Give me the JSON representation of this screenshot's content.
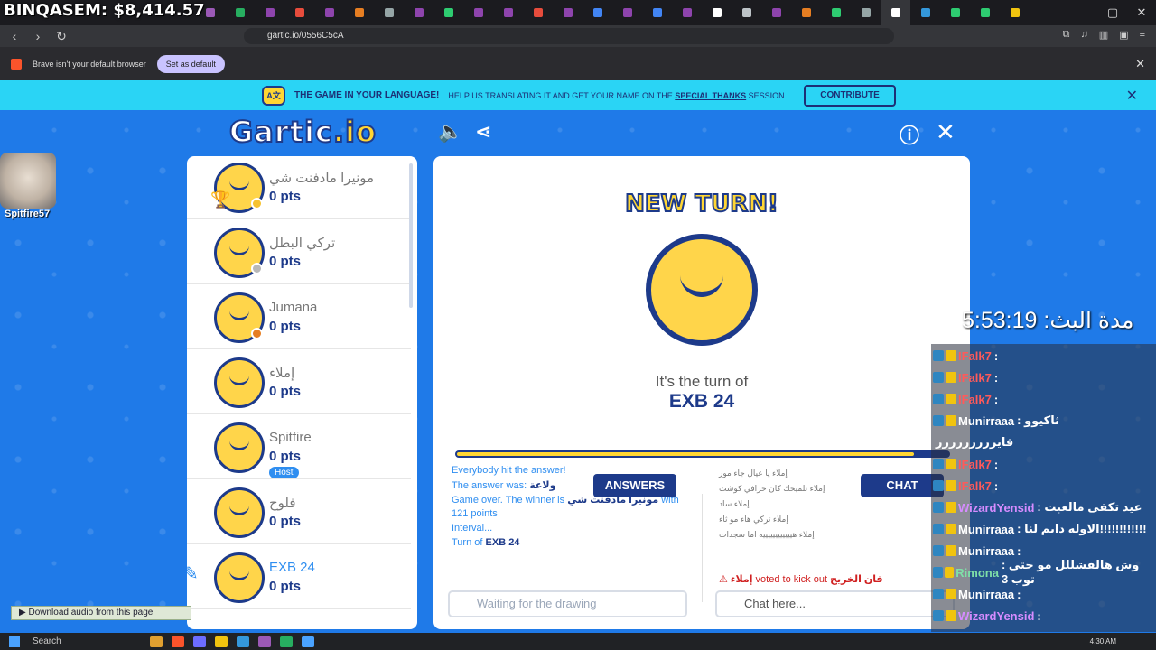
{
  "browser": {
    "url": "gartic.io/0556C5cA",
    "infobar_message": "Brave isn't your default browser",
    "set_default_label": "Set as default",
    "tab_colors": [
      "#9b59b6",
      "#27ae60",
      "#8e44ad",
      "#e74c3c",
      "#8e44ad",
      "#e67e22",
      "#95a5a6",
      "#8e44ad",
      "#2ecc71",
      "#8e44ad",
      "#8e44ad",
      "#e74c3c",
      "#8e44ad",
      "#4285f4",
      "#8e44ad",
      "#4285f4",
      "#8e44ad",
      "#ffffff",
      "#bdc3c7",
      "#8e44ad",
      "#e67e22",
      "#2ecc71",
      "#95a5a6",
      "#ffffff",
      "#3498db",
      "#2ecc71",
      "#2ecc71",
      "#f1c40f"
    ]
  },
  "stream_overlay": {
    "money": "BINQASEM: $8,414.57",
    "cam_name": "Spitfire57",
    "timer": "مدة البث: 5:53:19",
    "chat": [
      {
        "user": "IFalk7",
        "text": ":",
        "color": "#ff5a5a"
      },
      {
        "user": "IFalk7",
        "text": ":",
        "color": "#ff5a5a"
      },
      {
        "user": "IFalk7",
        "text": ":",
        "color": "#ff5a5a"
      },
      {
        "user": "Munirraaa",
        "text": ": ثاكيوو",
        "color": "#ffffff"
      },
      {
        "user": "",
        "text": "فايززززززززز",
        "color": "#ffffff"
      },
      {
        "user": "IFalk7",
        "text": ":",
        "color": "#ff5a5a"
      },
      {
        "user": "IFalk7",
        "text": ":",
        "color": "#ff5a5a"
      },
      {
        "user": "WizardYensid",
        "text": ": عيد تكفى مالعبت",
        "color": "#d68cff"
      },
      {
        "user": "Munirraaa",
        "text": ": الاوله دايم لنا!!!!!!!!!!!!",
        "color": "#ffffff"
      },
      {
        "user": "Munirraaa",
        "text": ":",
        "color": "#ffffff"
      },
      {
        "user": "Rimona",
        "text": ": وش هالفشللل مو حتى توب 3",
        "color": "#7fe0a8"
      },
      {
        "user": "Munirraaa",
        "text": ":",
        "color": "#ffffff"
      },
      {
        "user": "WizardYensid",
        "text": ":",
        "color": "#d68cff"
      }
    ]
  },
  "game": {
    "lang_bar": {
      "title": "THE GAME IN YOUR LANGUAGE!",
      "text": "HELP US TRANSLATING IT AND GET YOUR NAME ON THE",
      "link": "SPECIAL THANKS",
      "text_end": "SESSION",
      "contribute": "CONTRIBUTE"
    },
    "logo": "Gartic",
    "logo_io": ".io",
    "players": [
      {
        "name": "مونيرا مادفنت شي",
        "pts": "0 pts",
        "status": "#f6c230",
        "trophy": true
      },
      {
        "name": "تركي البطل",
        "pts": "0 pts",
        "status": "#b8b8b8"
      },
      {
        "name": "Jumana",
        "pts": "0 pts",
        "status": "#e67e22"
      },
      {
        "name": "إملاء",
        "pts": "0 pts",
        "status": ""
      },
      {
        "name": "Spitfire",
        "pts": "0 pts",
        "status": "",
        "host": "Host"
      },
      {
        "name": "فلوح",
        "pts": "0 pts",
        "status": ""
      },
      {
        "name": "EXB 24",
        "pts": "0 pts",
        "status": "",
        "active": true
      }
    ],
    "board": {
      "new_turn": "NEW TURN!",
      "turn_of": "It's the turn of",
      "turn_name": "EXB 24",
      "progress": 0.93
    },
    "answers_tab": "ANSWERS",
    "chat_tab": "CHAT",
    "answer_log": [
      {
        "text": "Everybody hit the answer!",
        "bold": ""
      },
      {
        "text": "The answer was:",
        "bold": "ولاعة"
      },
      {
        "text": "Game over. The winner is",
        "bold": "مونيرا مادفنت شي",
        "after": "with"
      },
      {
        "text": "121 points",
        "bold": ""
      },
      {
        "text": "Interval...",
        "bold": ""
      },
      {
        "text": "Turn of",
        "bold": "EXB 24"
      }
    ],
    "chat_log": [
      "إملاء يا عيال جاء مور",
      "إملاء تلميحك كان خرافي كوشت",
      "إملاء ساد",
      "إملاء تركي هاء مو ثاء",
      "إملاء هييييييييييييه اما سجدات"
    ],
    "vote_line": {
      "user": "إملاء",
      "text": "voted to kick out",
      "target": "فان الخريج"
    },
    "answer_placeholder": "Waiting for the drawing",
    "chat_placeholder": "Chat here..."
  },
  "download_bar": "Download audio from this page",
  "taskbar": {
    "search": "Search",
    "time": "4:30 AM"
  }
}
